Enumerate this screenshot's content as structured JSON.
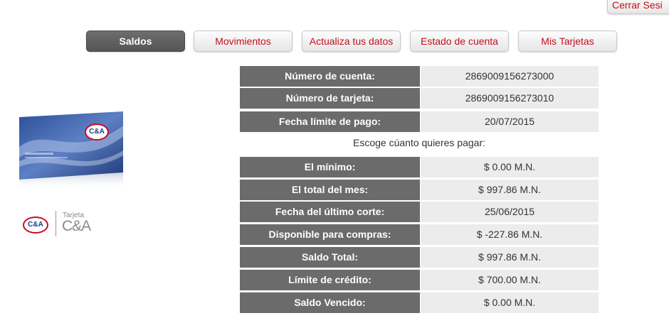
{
  "header": {
    "logout_label": "Cerrar Sesi"
  },
  "tabs": [
    {
      "label": "Saldos"
    },
    {
      "label": "Movimientos"
    },
    {
      "label": "Actualiza tus datos"
    },
    {
      "label": "Estado de cuenta"
    },
    {
      "label": "Mis Tarjetas"
    }
  ],
  "info": [
    {
      "label": "Número de cuenta:",
      "value": "2869009156273000"
    },
    {
      "label": "Número de tarjeta:",
      "value": "2869009156273010"
    },
    {
      "label": "Fecha límite de pago:",
      "value": "20/07/2015"
    }
  ],
  "choose_text": "Escoge cúanto quieres pagar:",
  "payments": [
    {
      "label": "El mínimo:",
      "value": "$ 0.00 M.N."
    },
    {
      "label": "El total del mes:",
      "value": "$ 997.86 M.N."
    },
    {
      "label": "Fecha del último corte:",
      "value": "25/06/2015"
    },
    {
      "label": "Disponible para compras:",
      "value": "$ -227.86 M.N."
    },
    {
      "label": "Saldo Total:",
      "value": "$ 997.86 M.N."
    },
    {
      "label": "Límite de crédito:",
      "value": "$ 700.00 M.N."
    },
    {
      "label": "Saldo Vencido:",
      "value": "$ 0.00 M.N."
    }
  ],
  "brand": {
    "card_logo": "C&A",
    "logo": "C&A",
    "tagline_small": "Tarjeta",
    "tagline_big": "C&A"
  },
  "colors": {
    "accent": "#c40e1e",
    "label_bg": "#6b6b6b",
    "value_bg": "#ececec",
    "active_tab": "#5f5f5f"
  }
}
